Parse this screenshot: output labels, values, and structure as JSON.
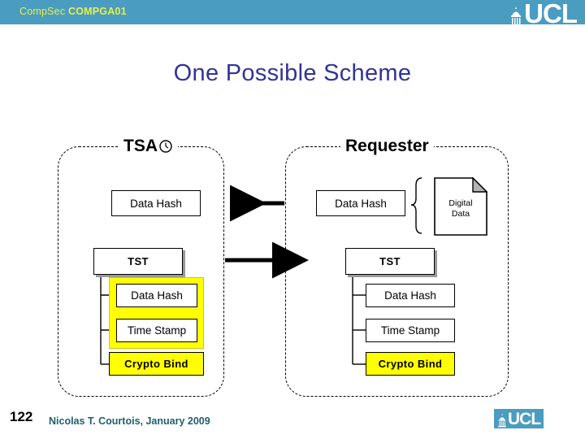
{
  "header": {
    "course_prefix": "CompSec ",
    "course_code": "COMPGA01",
    "logo_name": "ucl-logo",
    "logo_text": "UCL",
    "band_color": "#4a9cc0",
    "text_color": "#e8f04a"
  },
  "slide": {
    "title": "One Possible Scheme",
    "title_color": "#333399"
  },
  "diagram": {
    "accent_yellow": "#ffff00",
    "panels": [
      {
        "id": "tsa",
        "title": "TSA",
        "icon": "clock-icon",
        "boxes": {
          "data_hash_top": "Data Hash",
          "tst": "TST",
          "inner_hash": "Data Hash",
          "inner_time": "Time Stamp",
          "crypto_bind": "Crypto Bind"
        }
      },
      {
        "id": "requester",
        "title": "Requester",
        "boxes": {
          "data_hash_top": "Data Hash",
          "tst": "TST",
          "inner_hash": "Data Hash",
          "inner_time": "Time Stamp",
          "crypto_bind": "Crypto Bind"
        },
        "document": {
          "line1": "Digital",
          "line2": "Data",
          "icon": "document-icon"
        }
      }
    ],
    "arrows": [
      {
        "name": "arrow-requester-to-tsa",
        "direction": "left"
      },
      {
        "name": "arrow-tsa-to-requester",
        "direction": "right"
      }
    ]
  },
  "footer": {
    "page_number": "122",
    "credit": "Nicolas T. Courtois, January 2009",
    "credit_color": "#1f5f6b",
    "logo_text": "UCL"
  }
}
